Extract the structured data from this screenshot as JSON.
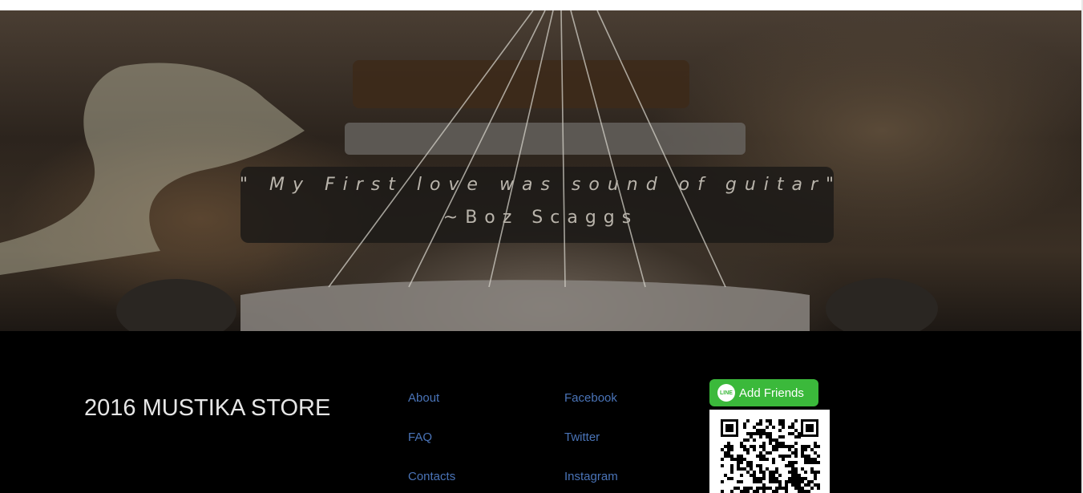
{
  "hero": {
    "quote": "\" My First love was sound of guitar\"",
    "author": "~Boz Scaggs"
  },
  "footer": {
    "brand": "2016 MUSTIKA STORE",
    "links_col1": [
      "About",
      "FAQ",
      "Contacts"
    ],
    "links_col2": [
      "Facebook",
      "Twitter",
      "Instagram"
    ],
    "line_button": {
      "logo": "LINE",
      "label": "Add Friends"
    },
    "link_color": "#4a74b8",
    "line_green": "#3bb93b"
  }
}
